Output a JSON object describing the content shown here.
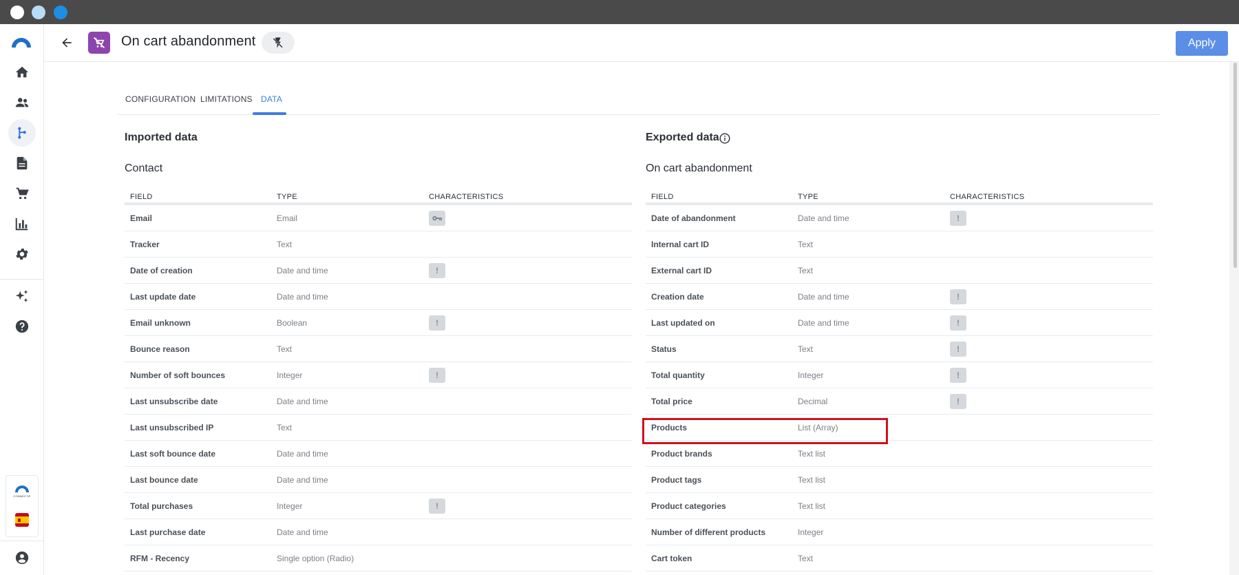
{
  "header": {
    "title": "On cart abandonment",
    "apply_label": "Apply"
  },
  "sidebar": {
    "items": [
      {
        "name": "home-icon"
      },
      {
        "name": "contacts-icon"
      },
      {
        "name": "workflow-icon",
        "active": true
      },
      {
        "name": "document-icon"
      },
      {
        "name": "cart-icon"
      },
      {
        "name": "chart-icon"
      },
      {
        "name": "settings-icon"
      },
      {
        "name": "sparkles-icon"
      },
      {
        "name": "help-icon"
      }
    ],
    "brand_text": "CONNECTIF"
  },
  "tabs": [
    {
      "label": "CONFIGURATION"
    },
    {
      "label": "LIMITATIONS"
    },
    {
      "label": "DATA",
      "active": true
    }
  ],
  "imported": {
    "title": "Imported data",
    "subtitle": "Contact",
    "headers": {
      "field": "FIELD",
      "type": "TYPE",
      "characteristics": "CHARACTERISTICS"
    },
    "rows": [
      {
        "field": "Email",
        "type": "Email",
        "badge": "key"
      },
      {
        "field": "Tracker",
        "type": "Text",
        "badge": ""
      },
      {
        "field": "Date of creation",
        "type": "Date and time",
        "badge": "!"
      },
      {
        "field": "Last update date",
        "type": "Date and time",
        "badge": ""
      },
      {
        "field": "Email unknown",
        "type": "Boolean",
        "badge": "!"
      },
      {
        "field": "Bounce reason",
        "type": "Text",
        "badge": ""
      },
      {
        "field": "Number of soft bounces",
        "type": "Integer",
        "badge": "!"
      },
      {
        "field": "Last unsubscribe date",
        "type": "Date and time",
        "badge": ""
      },
      {
        "field": "Last unsubscribed IP",
        "type": "Text",
        "badge": ""
      },
      {
        "field": "Last soft bounce date",
        "type": "Date and time",
        "badge": ""
      },
      {
        "field": "Last bounce date",
        "type": "Date and time",
        "badge": ""
      },
      {
        "field": "Total purchases",
        "type": "Integer",
        "badge": "!"
      },
      {
        "field": "Last purchase date",
        "type": "Date and time",
        "badge": ""
      },
      {
        "field": "RFM - Recency",
        "type": "Single option (Radio)",
        "badge": ""
      }
    ]
  },
  "exported": {
    "title": "Exported data",
    "subtitle": "On cart abandonment",
    "headers": {
      "field": "FIELD",
      "type": "TYPE",
      "characteristics": "CHARACTERISTICS"
    },
    "rows": [
      {
        "field": "Date of abandonment",
        "type": "Date and time",
        "badge": "!"
      },
      {
        "field": "Internal cart ID",
        "type": "Text",
        "badge": ""
      },
      {
        "field": "External cart ID",
        "type": "Text",
        "badge": ""
      },
      {
        "field": "Creation date",
        "type": "Date and time",
        "badge": "!"
      },
      {
        "field": "Last updated on",
        "type": "Date and time",
        "badge": "!"
      },
      {
        "field": "Status",
        "type": "Text",
        "badge": "!"
      },
      {
        "field": "Total quantity",
        "type": "Integer",
        "badge": "!"
      },
      {
        "field": "Total price",
        "type": "Decimal",
        "badge": "!"
      },
      {
        "field": "Products",
        "type": "List (Array)",
        "badge": ""
      },
      {
        "field": "Product brands",
        "type": "Text list",
        "badge": ""
      },
      {
        "field": "Product tags",
        "type": "Text list",
        "badge": ""
      },
      {
        "field": "Product categories",
        "type": "Text list",
        "badge": ""
      },
      {
        "field": "Number of different products",
        "type": "Integer",
        "badge": ""
      },
      {
        "field": "Cart token",
        "type": "Text",
        "badge": ""
      }
    ]
  },
  "colors": {
    "accent": "#3d7de0",
    "apply_button": "#5b8ee6",
    "module_icon": "#8e44ad",
    "highlight": "#d0101d"
  }
}
